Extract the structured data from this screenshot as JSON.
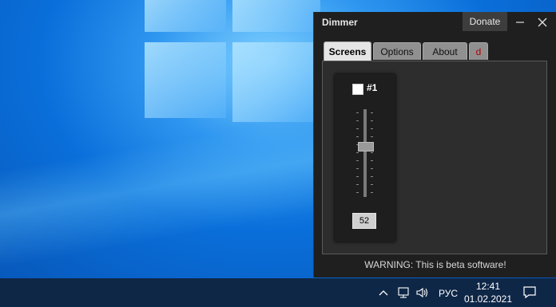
{
  "app": {
    "title": "Dimmer",
    "donate_label": "Donate",
    "tabs": [
      {
        "label": "Screens",
        "active": true
      },
      {
        "label": "Options",
        "active": false
      },
      {
        "label": "About",
        "active": false
      },
      {
        "label": "d",
        "active": false
      }
    ],
    "screen": {
      "checkbox_label": "#1",
      "checked": false,
      "dim_value": "52"
    },
    "warning": "WARNING: This is beta software!"
  },
  "taskbar": {
    "language": "РУС",
    "time": "12:41",
    "date": "01.02.2021"
  },
  "colors": {
    "window_bg": "#1f1f1f",
    "taskbar_bg": "#0f2747",
    "tab_red": "#b30000"
  }
}
